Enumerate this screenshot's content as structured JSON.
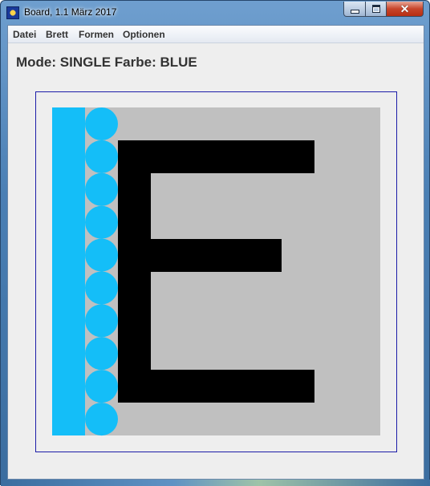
{
  "window": {
    "title": "Board, 1.1 März 2017",
    "controls": [
      "minimize",
      "maximize",
      "close"
    ]
  },
  "menubar": {
    "items": [
      {
        "label": "Datei"
      },
      {
        "label": "Brett"
      },
      {
        "label": "Formen"
      },
      {
        "label": "Optionen"
      }
    ]
  },
  "status": {
    "text": "Mode: SINGLE Farbe: BLUE"
  },
  "board": {
    "colors": {
      "background": "#c0c0c0",
      "selected": "#14bef8",
      "shape": "#000000",
      "frame": "#1c1ca8"
    },
    "left_column_circles": 10
  },
  "icons": {
    "app": "board-app-icon",
    "minimize": "minimize-icon",
    "maximize": "maximize-icon",
    "close": "close-icon"
  }
}
